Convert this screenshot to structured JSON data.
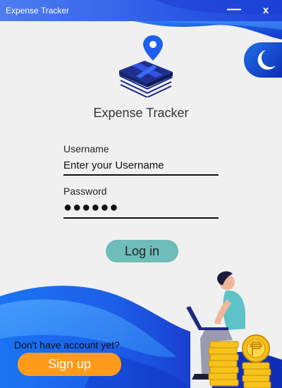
{
  "window": {
    "title": "Expense Tracker",
    "minimize_glyph": "—",
    "close_glyph": "x"
  },
  "app": {
    "title": "Expense Tracker"
  },
  "form": {
    "username_label": "Username",
    "username_value": "Enter your Username",
    "password_label": "Password",
    "password_value": "●●●●●●",
    "login_label": "Log in"
  },
  "signup": {
    "prompt": "Don't have account yet?",
    "button_label": "Sign up"
  },
  "icons": {
    "theme": "moon-icon",
    "logo": "money-stack-pin-icon",
    "minimize": "minimize-icon",
    "close": "close-icon"
  },
  "colors": {
    "titlebar": "#2c5be6",
    "wave": "#1e6ef0",
    "login_button": "#6ebdbb",
    "signup_button": "#ff9a1a"
  }
}
